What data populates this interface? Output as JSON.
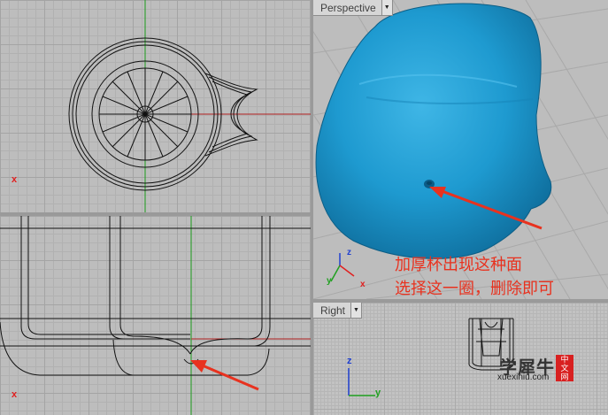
{
  "viewports": {
    "perspective": {
      "label": "Perspective"
    },
    "right": {
      "label": "Right"
    }
  },
  "axes": {
    "x": "x",
    "y": "y",
    "z": "z"
  },
  "annotation": {
    "line1": "加厚杯出现这种面",
    "line2": "选择这一圈，删除即可"
  },
  "watermark": {
    "name": "学犀牛",
    "badge": [
      "中",
      "文",
      "网"
    ],
    "url": "xuexiniu.com"
  },
  "colors": {
    "accent_arrow": "#e8321f",
    "mesh_blue": "#2aa3d6",
    "axis_x": "#e02020",
    "axis_y": "#20a020",
    "axis_z": "#2040d0"
  },
  "icons": [
    "dropdown-arrow-icon",
    "annotation-arrow-icon",
    "axis-gizmo-icon"
  ]
}
